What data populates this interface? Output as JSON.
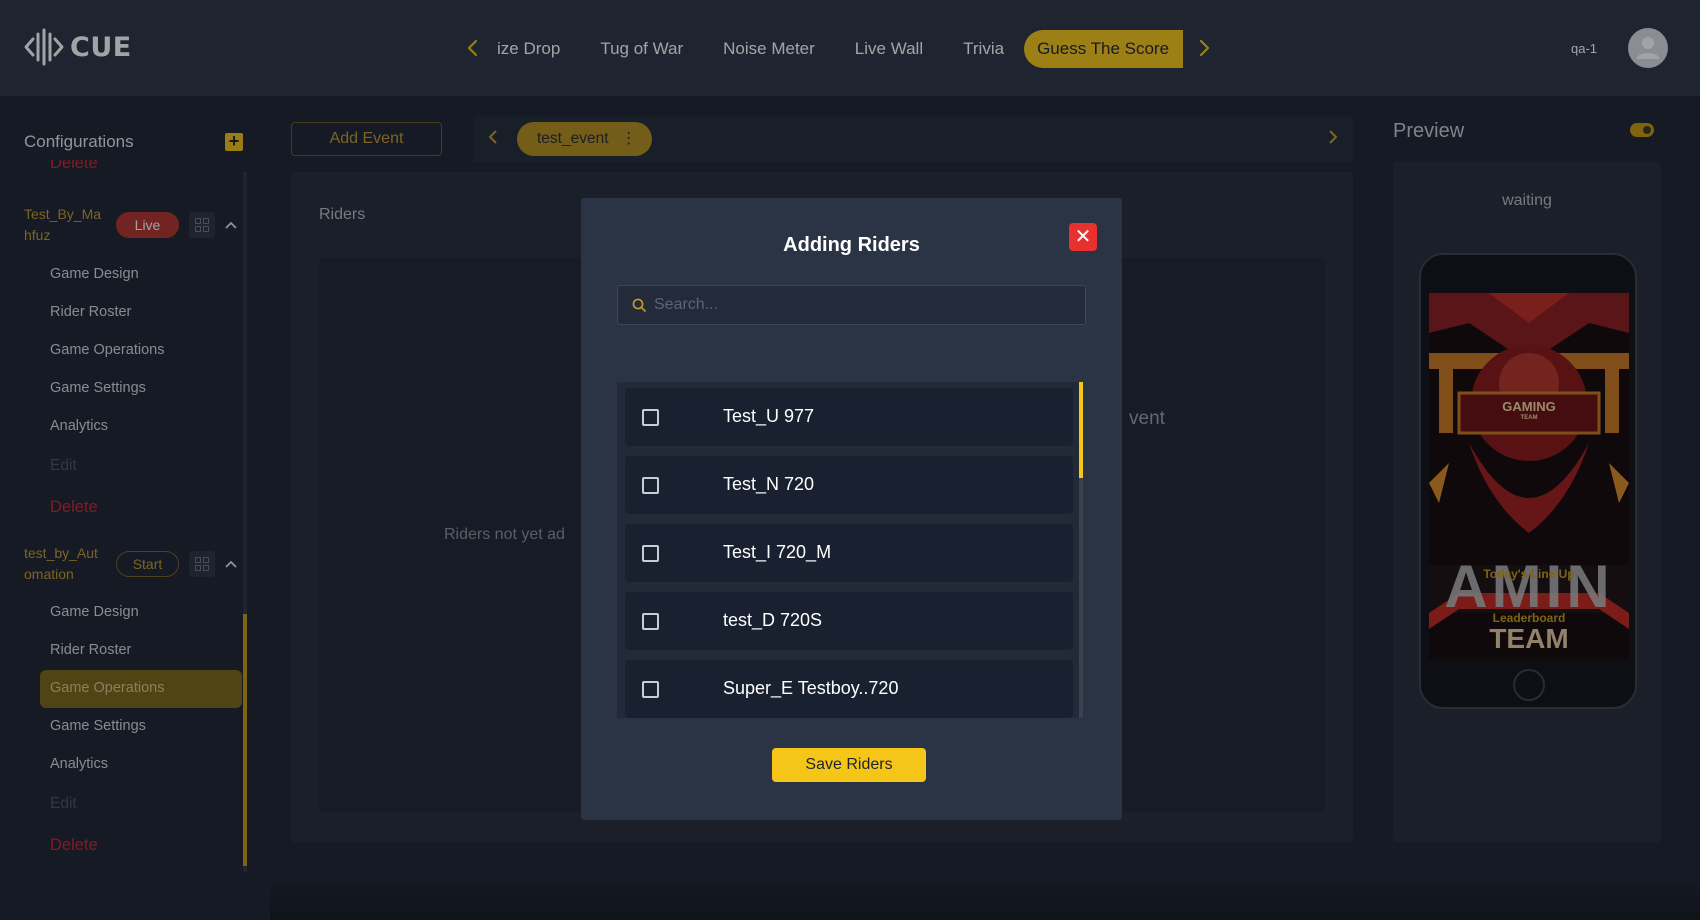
{
  "header": {
    "logo_text": "CUE",
    "tabs": [
      {
        "label": "ize Drop"
      },
      {
        "label": "Tug of War"
      },
      {
        "label": "Noise Meter"
      },
      {
        "label": "Live Wall"
      },
      {
        "label": "Trivia"
      },
      {
        "label": "Guess The Score"
      }
    ],
    "active_tab": "Guess The Score",
    "user_name": "qa-1"
  },
  "sidebar": {
    "title": "Configurations",
    "cut_item": "Delete",
    "groups": [
      {
        "name": "Test_By_Mahfuz",
        "name_line1": "Test_By_Ma",
        "name_line2": "hfuz",
        "badge": "Live",
        "items": [
          "Game Design",
          "Rider Roster",
          "Game Operations",
          "Game Settings",
          "Analytics"
        ],
        "edit_label": "Edit",
        "delete_label": "Delete"
      },
      {
        "name": "test_by_Automation",
        "name_line1": "test_by_Aut",
        "name_line2": "omation",
        "badge": "Start",
        "items": [
          "Game Design",
          "Rider Roster",
          "Game Operations",
          "Game Settings",
          "Analytics"
        ],
        "active_item": "Game Operations",
        "edit_label": "Edit",
        "delete_label": "Delete"
      }
    ]
  },
  "main": {
    "add_event_label": "Add Event",
    "event_pill": "test_event",
    "panel_title": "Riders",
    "empty_left": "Riders not yet ad",
    "empty_right": "vent"
  },
  "preview": {
    "title": "Preview",
    "status": "waiting",
    "screen_texts": {
      "gaming": "GAMING",
      "team_small": "TEAM",
      "lineup": "Today's Line Up",
      "leaderboard": "Leaderboard",
      "team_big": "TEAM",
      "amin": "AMIN"
    }
  },
  "modal": {
    "title": "Adding Riders",
    "search_placeholder": "Search...",
    "riders": [
      {
        "name": "Test_U 977",
        "checked": false
      },
      {
        "name": "Test_N 720",
        "checked": false
      },
      {
        "name": "Test_I 720_M",
        "checked": false
      },
      {
        "name": "test_D 720S",
        "checked": false
      },
      {
        "name": "Super_E Testboy..720",
        "checked": false
      }
    ],
    "save_label": "Save Riders"
  },
  "colors": {
    "accent": "#f5c518",
    "background": "#1c2230",
    "header": "#2b3445",
    "danger": "#e8302e"
  }
}
